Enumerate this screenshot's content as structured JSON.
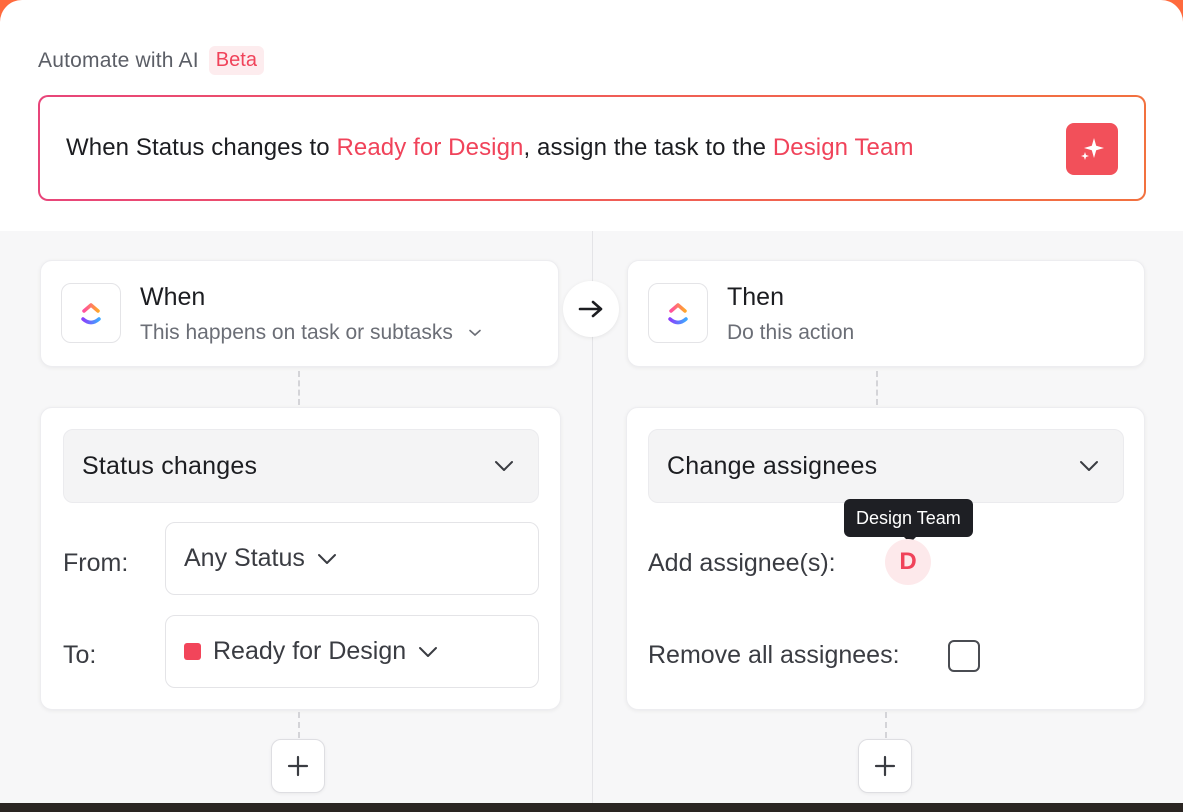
{
  "header": {
    "title": "Automate with AI",
    "badge": "Beta"
  },
  "prompt": {
    "part1": "When Status changes to ",
    "highlight1": "Ready for Design",
    "part2": ", assign the task to the ",
    "highlight2": "Design Team"
  },
  "trigger": {
    "title": "When",
    "subtitle": "This happens on task or subtasks"
  },
  "action": {
    "title": "Then",
    "subtitle": "Do this action"
  },
  "trigger_detail": {
    "select": "Status changes",
    "from_label": "From:",
    "from_value": "Any Status",
    "to_label": "To:",
    "to_value": "Ready for Design"
  },
  "action_detail": {
    "select": "Change assignees",
    "add_label": "Add assignee(s):",
    "tooltip": "Design Team",
    "avatar_initial": "D",
    "remove_label": "Remove all assignees:",
    "remove_checked": false
  },
  "colors": {
    "accent": "#f0435a",
    "status": "#f2455a",
    "gradient_start": "#e8457a",
    "gradient_end": "#f2713f"
  },
  "icons": [
    "sparkle-icon",
    "clickup-logo-icon",
    "arrow-right-icon",
    "chevron-down-icon",
    "plus-icon"
  ]
}
